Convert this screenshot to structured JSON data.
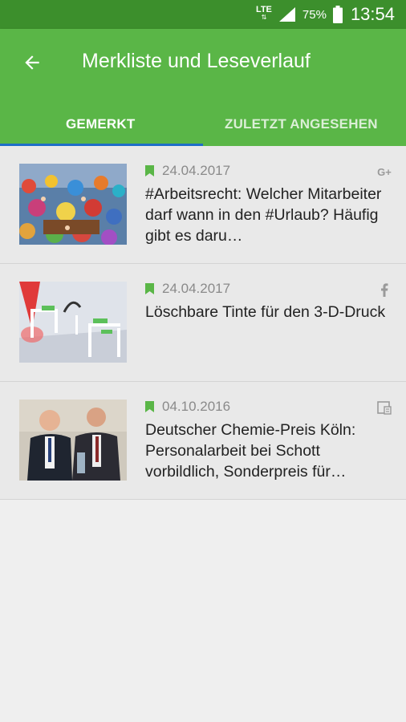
{
  "status": {
    "network": "LTE",
    "battery": "75%",
    "time": "13:54"
  },
  "appbar": {
    "title": "Merkliste und Leseverlauf"
  },
  "tabs": [
    {
      "label": "GEMERKT",
      "active": true
    },
    {
      "label": "ZULETZT ANGESEHEN",
      "active": false
    }
  ],
  "items": [
    {
      "date": "24.04.2017",
      "title": "#Arbeitsrecht: Welcher Mitarbeiter darf wann in den #Urlaub? Häufig gibt es daru…",
      "source_icon": "google-plus-icon",
      "image": "beach-crowd"
    },
    {
      "date": "24.04.2017",
      "title": "Löschbare Tinte für den 3-D-Druck",
      "source_icon": "facebook-icon",
      "image": "3d-print-render"
    },
    {
      "date": "04.10.2016",
      "title": "Deutscher Chemie-Preis Köln: Personalarbeit bei Schott vorbildlich, Sonderpreis für…",
      "source_icon": "article-icon",
      "image": "award-photo"
    }
  ],
  "colors": {
    "appbar": "#5ab647",
    "statusbar": "#3c8f2c",
    "indicator": "#1e6ec8",
    "bookmark": "#5ab647"
  }
}
